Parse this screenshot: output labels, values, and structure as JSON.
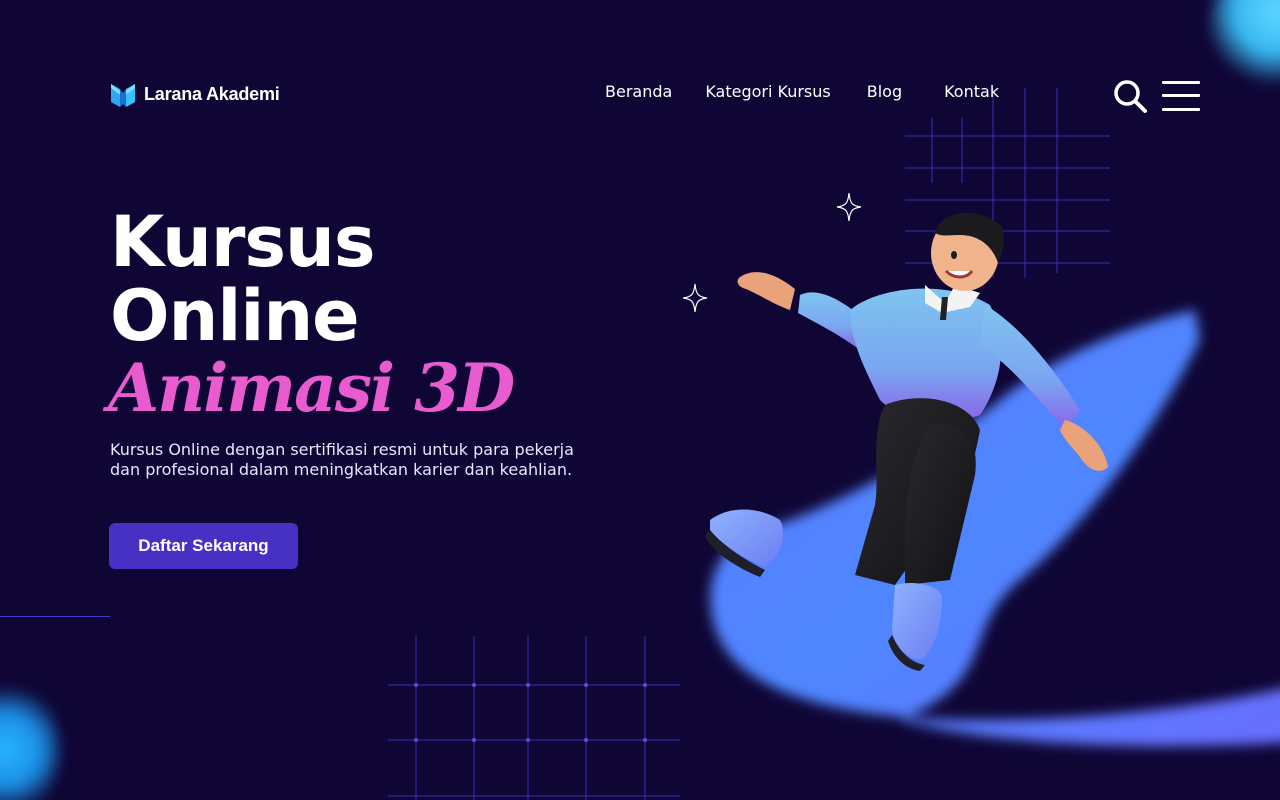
{
  "brand": {
    "name": "Larana Akademi",
    "logo_icon": "book-logo-icon",
    "logo_colors": [
      "#2ea8f5",
      "#36c2ff"
    ]
  },
  "nav": {
    "items": [
      {
        "label": "Beranda"
      },
      {
        "label": "Kategori Kursus"
      },
      {
        "label": "Blog"
      },
      {
        "label": "Kontak"
      }
    ],
    "search_icon": "search-icon",
    "menu_icon": "hamburger-menu-icon"
  },
  "hero": {
    "title_line1": "Kursus",
    "title_line2": "Online",
    "title_accent": "Animasi 3D",
    "description": "Kursus Online dengan sertifikasi resmi untuk para pekerja dan profesional dalam meningkatkan karier dan keahlian.",
    "cta_label": "Daftar Sekarang"
  },
  "colors": {
    "background": "#0f0636",
    "accent_pink": "#e85ccf",
    "button": "#4730c4",
    "blob_blue": "#4c7dff",
    "grid_line": "#3a2fb5"
  },
  "illustration": {
    "name": "floating-3d-man-illustration",
    "decorations": [
      "sparkle-icon",
      "sparkle-icon"
    ]
  }
}
